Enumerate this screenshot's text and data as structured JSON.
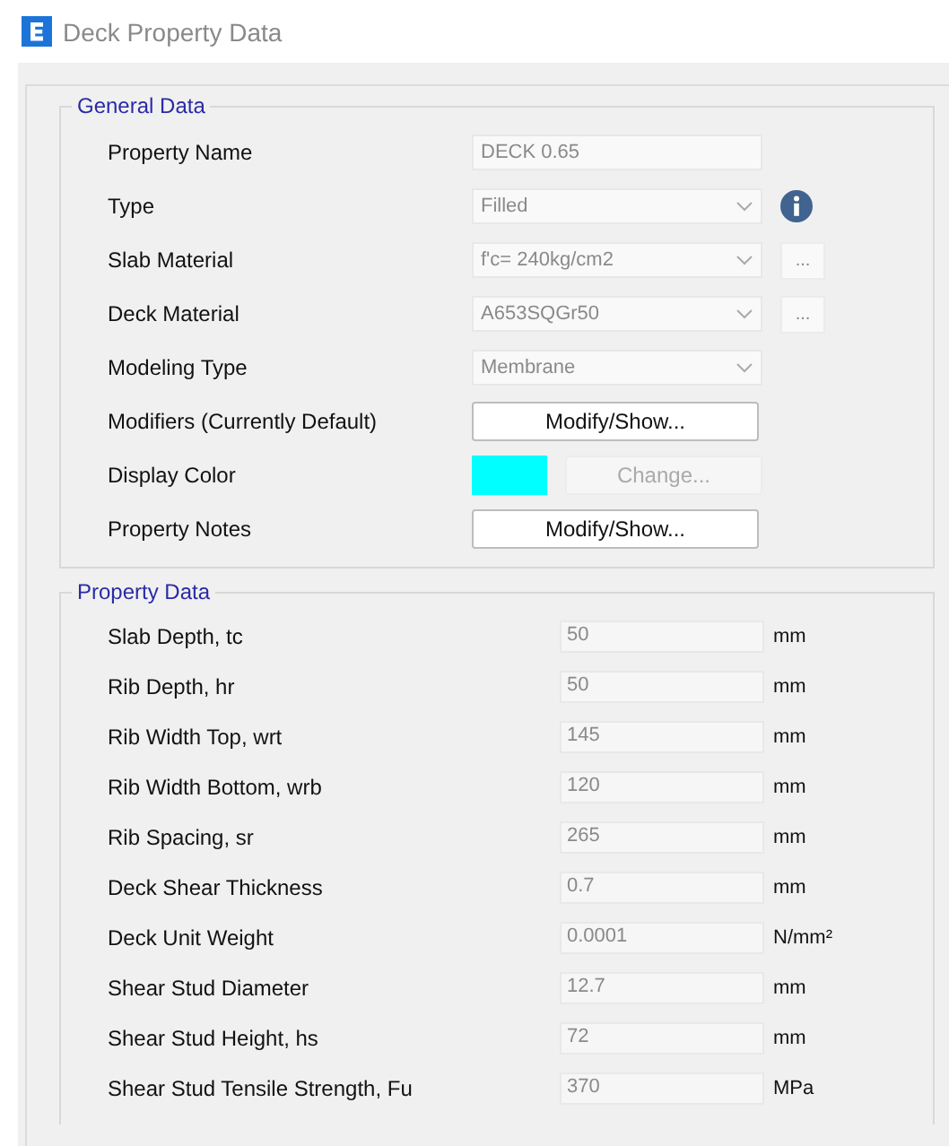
{
  "window": {
    "title": "Deck Property Data"
  },
  "general_data": {
    "title": "General Data",
    "rows": [
      {
        "label": "Property Name",
        "kind": "text",
        "value": "DECK 0.65"
      },
      {
        "label": "Type",
        "kind": "select",
        "value": "Filled",
        "accessory": {
          "kind": "info"
        }
      },
      {
        "label": "Slab Material",
        "kind": "select",
        "value": "f'c= 240kg/cm2",
        "accessory": {
          "kind": "button",
          "label": "..."
        }
      },
      {
        "label": "Deck Material",
        "kind": "select",
        "value": "A653SQGr50",
        "accessory": {
          "kind": "button",
          "label": "..."
        }
      },
      {
        "label": "Modeling Type",
        "kind": "select",
        "value": "Membrane"
      },
      {
        "label": "Modifiers (Currently Default)",
        "kind": "button",
        "button": {
          "label": "Modify/Show...",
          "disabled": false
        }
      },
      {
        "label": "Display Color",
        "kind": "color",
        "color": "#00ffff",
        "button": {
          "label": "Change...",
          "disabled": true
        }
      },
      {
        "label": "Property Notes",
        "kind": "button",
        "button": {
          "label": "Modify/Show...",
          "disabled": false
        }
      }
    ]
  },
  "property_data": {
    "title": "Property Data",
    "rows": [
      {
        "label": "Slab Depth, tc",
        "value": "50",
        "unit": "mm"
      },
      {
        "label": "Rib Depth, hr",
        "value": "50",
        "unit": "mm"
      },
      {
        "label": "Rib Width Top, wrt",
        "value": "145",
        "unit": "mm"
      },
      {
        "label": "Rib Width Bottom, wrb",
        "value": "120",
        "unit": "mm"
      },
      {
        "label": "Rib Spacing, sr",
        "value": "265",
        "unit": "mm"
      },
      {
        "label": "Deck Shear Thickness",
        "value": "0.7",
        "unit": "mm"
      },
      {
        "label": "Deck Unit Weight",
        "value": "0.0001",
        "unit": "N/mm²"
      },
      {
        "label": "Shear Stud Diameter",
        "value": "12.7",
        "unit": "mm"
      },
      {
        "label": "Shear Stud Height, hs",
        "value": "72",
        "unit": "mm"
      },
      {
        "label": "Shear Stud Tensile Strength, Fu",
        "value": "370",
        "unit": "MPa"
      }
    ]
  }
}
